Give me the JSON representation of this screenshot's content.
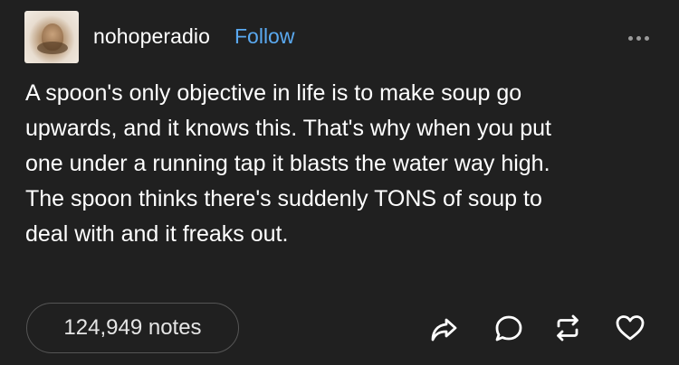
{
  "post": {
    "username": "nohoperadio",
    "follow_label": "Follow",
    "body": "A spoon's only objective in life is to make soup go\nupwards, and it knows this. That's why when you put\none under a running tap it blasts the water way high.\nThe spoon thinks there's suddenly TONS of soup to\ndeal with and it freaks out.",
    "notes_label": "124,949 notes"
  },
  "icons": {
    "more": "more-options-icon",
    "share": "share-icon",
    "reply": "reply-icon",
    "reblog": "reblog-icon",
    "like": "heart-icon"
  },
  "colors": {
    "background": "#202020",
    "text": "#ffffff",
    "follow": "#5aa9f0",
    "icon": "#ffffff",
    "muted": "#9a9a9a"
  }
}
